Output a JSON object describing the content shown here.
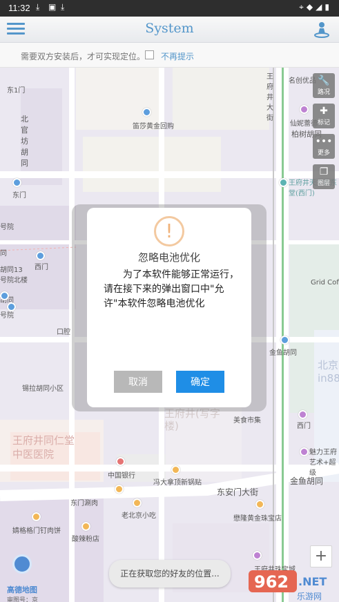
{
  "status_bar": {
    "time": "11:32"
  },
  "header": {
    "title": "System"
  },
  "notice": {
    "text": "需要双方安装后，才可实现定位。",
    "dont_show": "不再提示"
  },
  "map": {
    "labels": {
      "east1gate": "东1门",
      "beiguanfang": "北官坊胡同",
      "dongmen1": "东门",
      "xihaoqi": "号院",
      "xitong": "同",
      "hutong13": "胡同13号院北楼",
      "ximen": "西门",
      "hutong": "胡同",
      "haoyuan": "号院",
      "kouzhen": "口腔",
      "xilahutong": "锡拉胡同小区",
      "jindi": "笛莎黄金回购",
      "wfj_hospital": "王府井同仁堂中医医院",
      "wfj_square": "王府井(写字楼)",
      "meishi": "美食市集",
      "zhongguo_yinhang": "中国银行",
      "fengdaxiang": "冯大拿顶新锅贴",
      "dongmen_jianrou": "东门涮肉",
      "laobeijing": "老北京小吃",
      "jingfu": "婧格格门钉肉饼",
      "suiyuan": "酸辣粉店",
      "dongan": "东安门大街",
      "jinyu": "金鱼胡同",
      "jinyu2": "金鱼胡同",
      "jinbao": "懋隆黄金珠宝店",
      "wangfujing_st": "王府井大街",
      "mingyou": "名创优品",
      "xianfeng": "仙妮蕾德",
      "baishu": "柏树胡同",
      "tianhui": "王府井天主教东堂(西门)",
      "grid": "Grid Coffee",
      "beijing_in": "北京 in88",
      "ximen2": "西门",
      "meili": "魅力王府艺术+超级",
      "wangfu_jewel": "王府井珠宝城"
    },
    "tools": [
      "路况",
      "标记",
      "更多",
      "图层"
    ],
    "zoom_in": "+",
    "logo": "高德地图",
    "logo_sub": "审图号：京"
  },
  "dialog": {
    "title": "忽略电池优化",
    "body": "为了本软件能够正常运行，请在接下来的弹出窗口中\"允许\"本软件忽略电池优化",
    "cancel": "取消",
    "ok": "确定"
  },
  "toast": "正在获取您的好友的位置..."
}
